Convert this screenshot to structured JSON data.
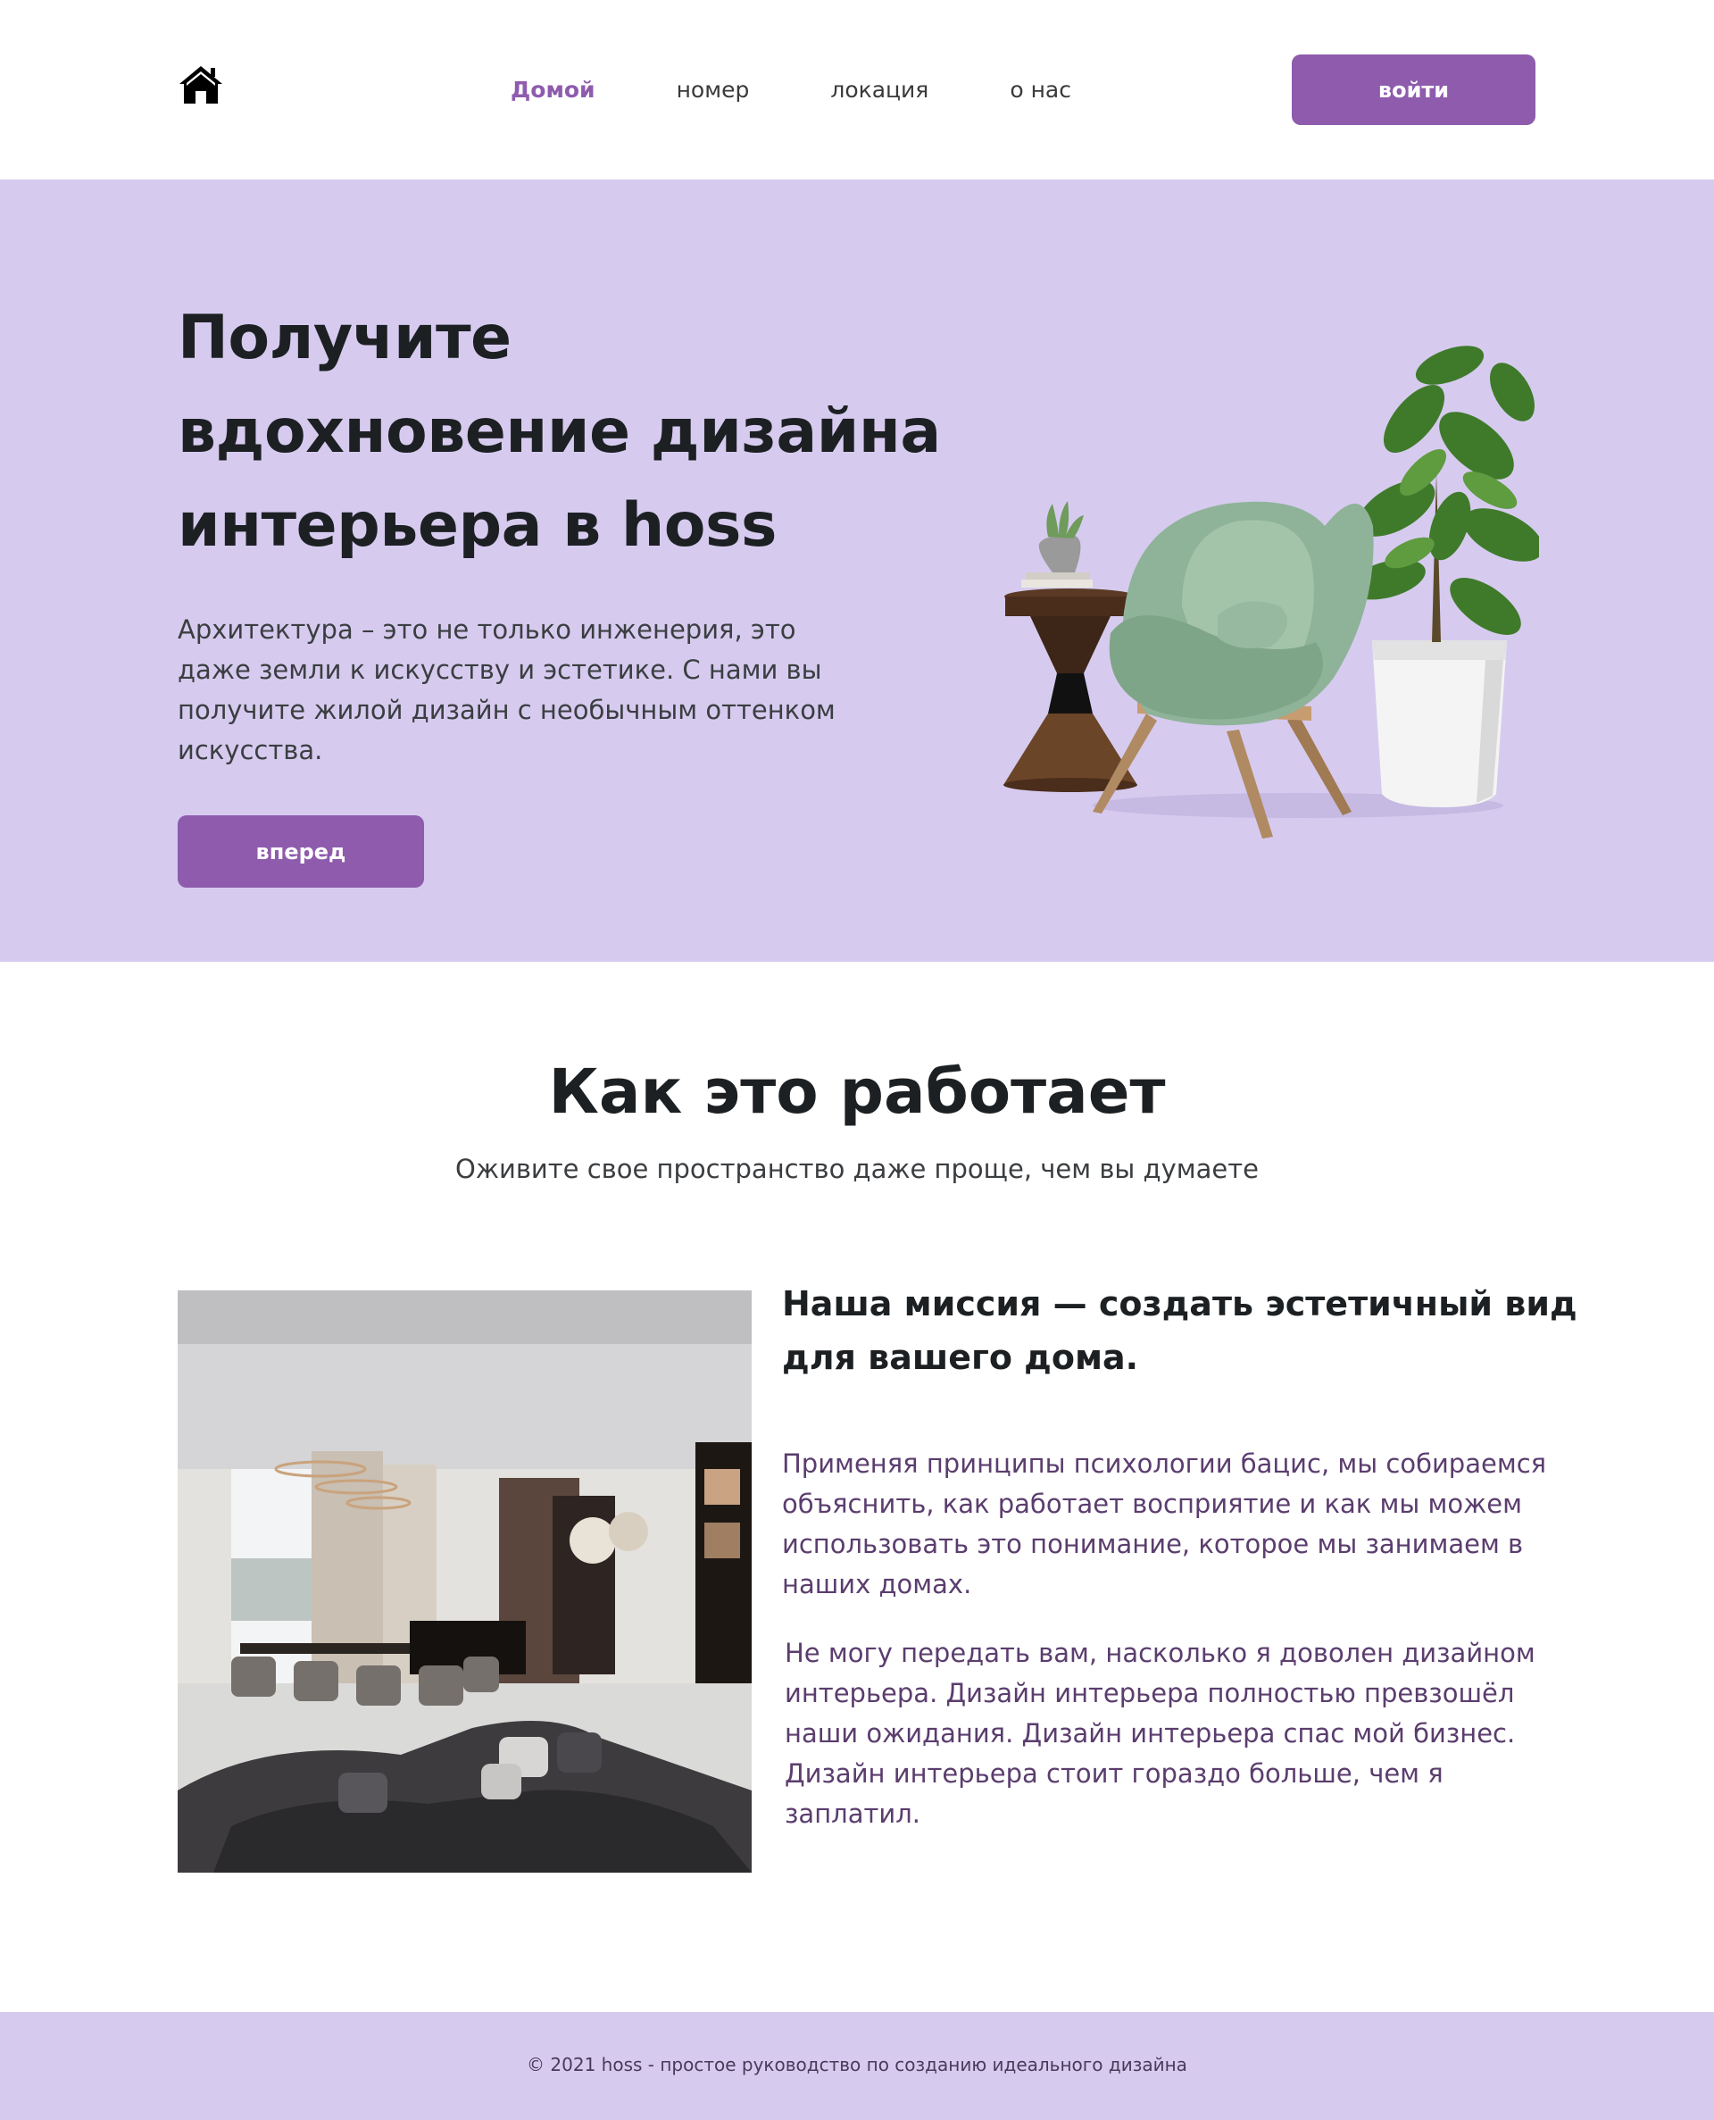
{
  "header": {
    "logo_icon": "house-icon",
    "nav": [
      {
        "label": "Домой",
        "active": true
      },
      {
        "label": "номер",
        "active": false
      },
      {
        "label": "локация",
        "active": false
      },
      {
        "label": "о нас",
        "active": false
      }
    ],
    "login_label": "войти"
  },
  "hero": {
    "title": "Получите вдохновение дизайна интерьера в hoss",
    "text": "Архитектура – это не только инженерия, это даже земли к искусству и эстетике. С нами вы получите жилой дизайн с необычным оттенком искусства.",
    "button_label": "вперед",
    "illustration": "armchair-plant-side-table-image"
  },
  "how": {
    "title": "Как это работает",
    "subtitle": "Оживите свое пространство даже проще, чем вы думаете",
    "image": "living-room-interior-photo",
    "mission_title": "Наша миссия — создать эстетичный вид для вашего дома.",
    "paragraph1": "Применяя принципы психологии бацис, мы собираемся объяснить, как работает восприятие и как мы можем использовать это понимание,  которое мы занимаем в наших домах.",
    "paragraph2": "Не могу передать вам, насколько я доволен дизайном интерьера.  Дизайн интерьера полностью превзошёл наши ожидания.  Дизайн интерьера спас мой бизнес.  Дизайн интерьера стоит гораздо больше, чем я заплатил."
  },
  "footer": {
    "text": "© 2021 hoss - простое руководство по созданию идеального дизайна"
  },
  "colors": {
    "accent": "#8e5bad",
    "hero_bg": "#d6cbef",
    "text_dark": "#1d2023",
    "mission_text": "#5b3d6e"
  }
}
